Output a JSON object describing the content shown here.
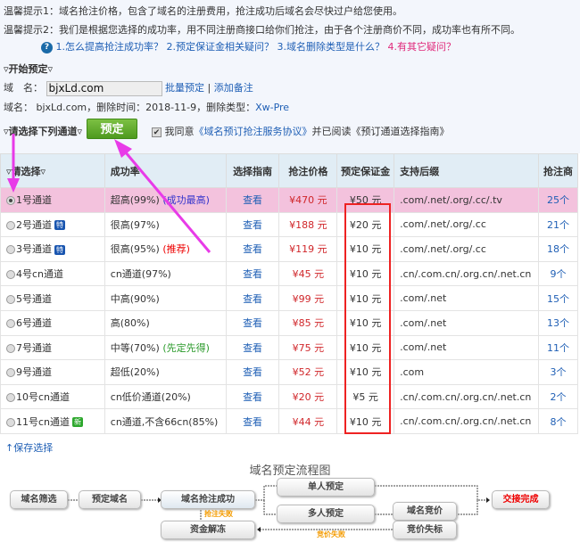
{
  "tips": {
    "tip1": "温馨提示1：域名抢注价格，包含了域名的注册费用，抢注成功后域名会尽快过户给您使用。",
    "tip2": "温馨提示2：我们是根据您选择的成功率，用不同注册商接口给你们抢注，由于各个注册商价不同，成功率也有所不同。"
  },
  "faq": [
    "1.怎么提高抢注成功率？",
    "2.预定保证金相关疑问？",
    "3.域名删除类型是什么？",
    "4.有其它疑问？"
  ],
  "form": {
    "section": "开始预定",
    "domain_label": "域　名：",
    "domain_value": "bjxLd.com",
    "batch": "批量预定",
    "sep": "|",
    "note": "添加备注",
    "info_prefix": "域名： bjxLd.com，删除时间：2018-11-9，删除类型：",
    "info_type": "Xw-Pre",
    "choose": "请选择下列通道",
    "submit": "预定",
    "agree": "我同意",
    "agreement": "《域名预订抢注服务协议》",
    "read": "并已阅读",
    "guide": "《预订通道选择指南》"
  },
  "table": {
    "headers": [
      "请选择",
      "成功率",
      "选择指南",
      "抢注价格",
      "预定保证金",
      "支持后缀",
      "抢注商"
    ],
    "rows": [
      {
        "name": "1号通道",
        "rate": "超高(99%)",
        "note": "(成功最高)",
        "note_type": "blue",
        "guide": "查看",
        "price": "¥470 元",
        "deposit": "¥50 元",
        "suffix": ".com/.net/.org/.cc/.tv",
        "count": "25个",
        "selected": true
      },
      {
        "name": "2号通道",
        "tag": "特",
        "rate": "很高(97%)",
        "guide": "查看",
        "price": "¥188 元",
        "deposit": "¥20 元",
        "suffix": ".com/.net/.org/.cc",
        "count": "21个"
      },
      {
        "name": "3号通道",
        "tag": "特",
        "rate": "很高(95%)",
        "note": "(推荐)",
        "note_type": "red",
        "guide": "查看",
        "price": "¥119 元",
        "deposit": "¥10 元",
        "suffix": ".com/.net/.org/.cc",
        "count": "18个"
      },
      {
        "name": "4号cn通道",
        "rate": "cn通道(97%)",
        "guide": "查看",
        "price": "¥45 元",
        "deposit": "¥10 元",
        "suffix": ".cn/.com.cn/.org.cn/.net.cn",
        "count": "9个"
      },
      {
        "name": "5号通道",
        "rate": "中高(90%)",
        "guide": "查看",
        "price": "¥99 元",
        "deposit": "¥10 元",
        "suffix": ".com/.net",
        "count": "15个"
      },
      {
        "name": "6号通道",
        "rate": "高(80%)",
        "guide": "查看",
        "price": "¥85 元",
        "deposit": "¥10 元",
        "suffix": ".com/.net",
        "count": "13个"
      },
      {
        "name": "7号通道",
        "rate": "中等(70%)",
        "note": "(先定先得)",
        "note_type": "green",
        "guide": "查看",
        "price": "¥75 元",
        "deposit": "¥10 元",
        "suffix": ".com/.net",
        "count": "11个"
      },
      {
        "name": "9号通道",
        "rate": "超低(20%)",
        "guide": "查看",
        "price": "¥52 元",
        "deposit": "¥10 元",
        "suffix": ".com",
        "count": "3个"
      },
      {
        "name": "10号cn通道",
        "rate": "cn低价通道(20%)",
        "guide": "查看",
        "price": "¥20 元",
        "deposit": "¥5 元",
        "suffix": ".cn/.com.cn/.org.cn/.net.cn",
        "count": "2个"
      },
      {
        "name": "11号cn通道",
        "tag": "新",
        "rate": "cn通道,不含66cn(85%)",
        "guide": "查看",
        "price": "¥44 元",
        "deposit": "¥10 元",
        "suffix": ".cn/.com.cn/.org.cn/.net.cn",
        "count": "8个"
      }
    ]
  },
  "save": "↑保存选择",
  "flow": {
    "title": "域名预定流程图",
    "filter": "域名筛选",
    "reserve": "预定域名",
    "success": "域名抢注成功",
    "single": "单人预定",
    "multi": "多人预定",
    "auction": "域名竞价",
    "lost": "竞价失标",
    "unfreeze": "资金解冻",
    "done": "交接完成",
    "fail": "抢注失败",
    "auction_fail": "竞价失败"
  }
}
